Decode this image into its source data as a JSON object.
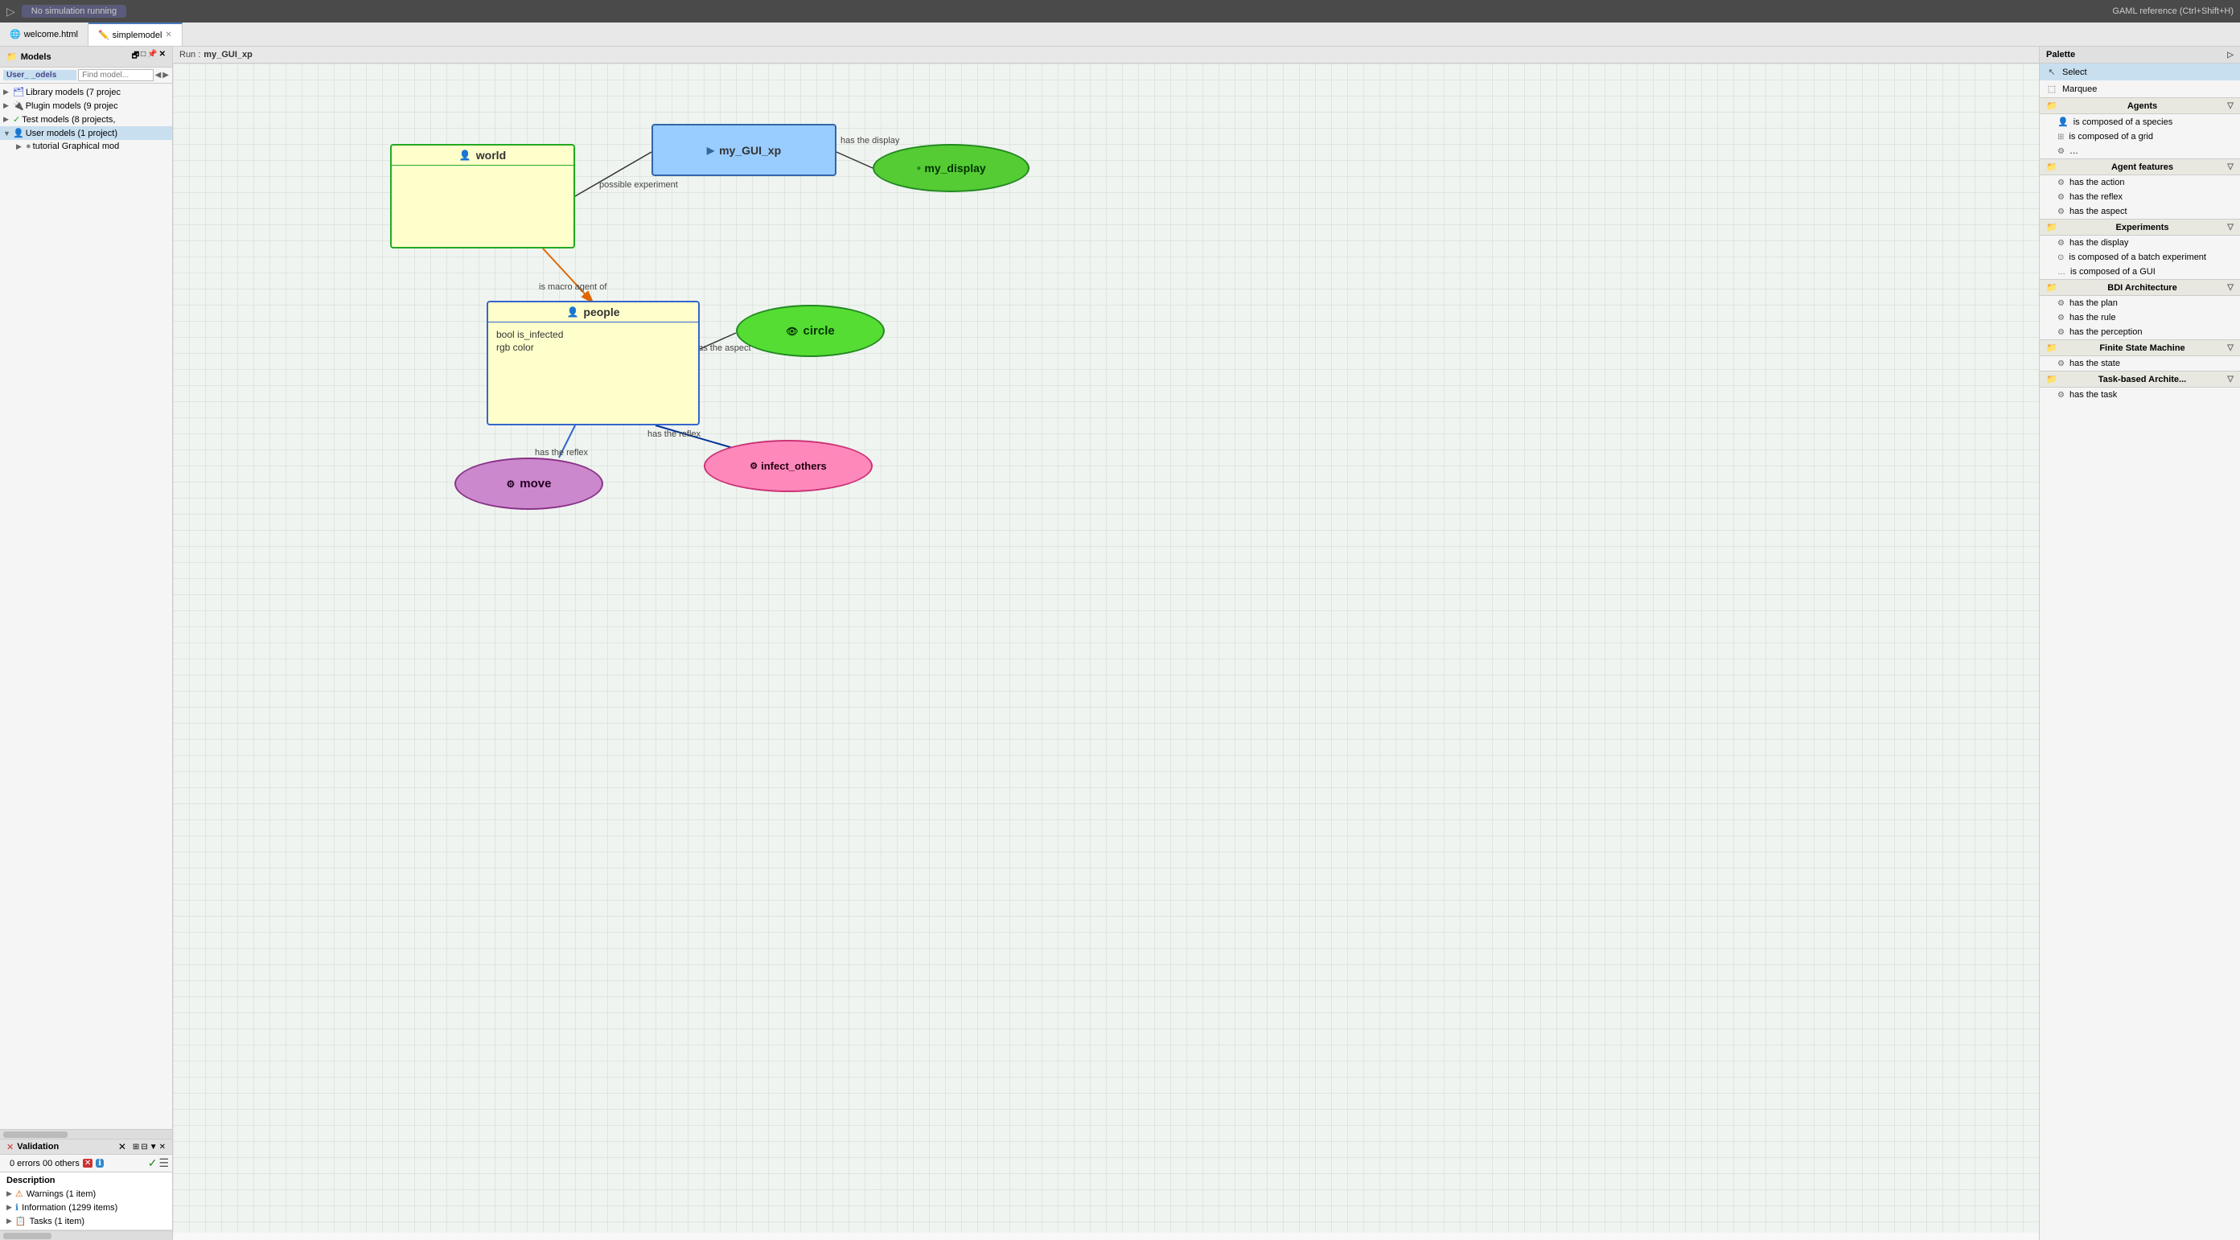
{
  "topbar": {
    "simulation_status": "No simulation running",
    "gaml_ref": "GAML reference (Ctrl+Shift+H)"
  },
  "tabs": [
    {
      "id": "welcome",
      "label": "welcome.html",
      "active": false
    },
    {
      "id": "simplemodel",
      "label": "simplemodel",
      "active": true
    }
  ],
  "canvas_toolbar": {
    "run_label": "Run :",
    "run_name": "my_GUI_xp"
  },
  "left_panel": {
    "header": "Models",
    "find_placeholder": "Find model...",
    "tree_items": [
      {
        "label": "User_ _odels",
        "level": 0,
        "icon": "folder",
        "color": "green",
        "expanded": false
      },
      {
        "label": "Library models (7 projec",
        "level": 1,
        "icon": "lib",
        "color": "blue"
      },
      {
        "label": "Plugin models (9 projec",
        "level": 1,
        "icon": "plugin",
        "color": "orange"
      },
      {
        "label": "Test models (8 projects,",
        "level": 1,
        "icon": "test",
        "color": "green"
      },
      {
        "label": "User models (1 project)",
        "level": 1,
        "icon": "user",
        "color": "blue",
        "expanded": true,
        "selected": true
      },
      {
        "label": "tutorial Graphical mod",
        "level": 2,
        "icon": "file",
        "color": "gray"
      }
    ]
  },
  "validation": {
    "label": "Validation",
    "errors_summary": "0 errors   00 others",
    "description_label": "Description",
    "items": [
      {
        "type": "warning",
        "label": "Warnings (1 item)"
      },
      {
        "type": "info",
        "label": "Information (1299 items)"
      },
      {
        "type": "task",
        "label": "Tasks (1 item)"
      }
    ]
  },
  "diagram": {
    "nodes": {
      "world": {
        "label": "world"
      },
      "gui": {
        "label": "my_GUI_xp"
      },
      "display": {
        "label": "my_display"
      },
      "people": {
        "label": "people",
        "attributes": [
          "bool is_infected",
          "rgb color"
        ]
      },
      "circle": {
        "label": "circle"
      },
      "move": {
        "label": "move"
      },
      "infect": {
        "label": "infect_others"
      }
    },
    "edge_labels": {
      "possible_experiment": "possible experiment",
      "has_the_display": "has the display",
      "is_macro_agent_of": "is macro agent of",
      "has_the_aspect": "has the aspect",
      "has_the_reflex_move": "has the reflex",
      "has_the_reflex_infect": "has the reflex"
    }
  },
  "palette": {
    "header": "Palette",
    "tools": [
      {
        "id": "select",
        "label": "Select",
        "icon": "cursor"
      },
      {
        "id": "marquee",
        "label": "Marquee",
        "icon": "marquee"
      }
    ],
    "sections": [
      {
        "id": "agents",
        "label": "Agents",
        "items": [
          {
            "id": "is-composed-of-species",
            "label": "is composed of a species"
          },
          {
            "id": "is-composed-of-grid",
            "label": "is composed of a grid"
          }
        ]
      },
      {
        "id": "agent-features",
        "label": "Agent features",
        "items": [
          {
            "id": "has-the-action",
            "label": "has the action"
          },
          {
            "id": "has-the-reflex",
            "label": "has the reflex"
          },
          {
            "id": "has-the-aspect",
            "label": "has the aspect"
          }
        ]
      },
      {
        "id": "experiments",
        "label": "Experiments",
        "items": [
          {
            "id": "has-the-display",
            "label": "has the display"
          },
          {
            "id": "is-composed-of-batch",
            "label": "is composed of a batch experiment"
          },
          {
            "id": "is-composed-of-gui",
            "label": "is composed of a GUI"
          }
        ]
      },
      {
        "id": "bdi",
        "label": "BDI Architecture",
        "items": [
          {
            "id": "has-the-plan",
            "label": "has the plan"
          },
          {
            "id": "has-the-rule",
            "label": "has the rule"
          },
          {
            "id": "has-the-perception",
            "label": "has the perception"
          }
        ]
      },
      {
        "id": "fsm",
        "label": "Finite State Machine",
        "items": [
          {
            "id": "has-the-state",
            "label": "has the state"
          }
        ]
      },
      {
        "id": "task-arch",
        "label": "Task-based Archite...",
        "items": [
          {
            "id": "has-the-task",
            "label": "has the task"
          }
        ]
      }
    ]
  }
}
